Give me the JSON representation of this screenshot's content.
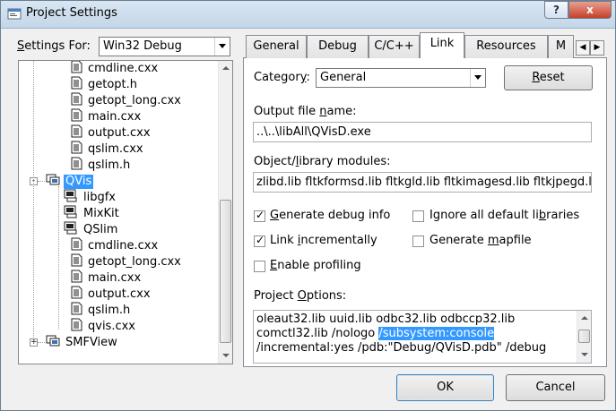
{
  "window": {
    "title": "Project Settings",
    "help_label": "?",
    "close_label": "x"
  },
  "settings_for": {
    "label_pre": "",
    "label_u": "S",
    "label_post": "ettings For:",
    "value": "Win32 Debug"
  },
  "tree": {
    "rows": [
      {
        "label": "cmdline.cxx",
        "kind": "file"
      },
      {
        "label": "getopt.h",
        "kind": "file"
      },
      {
        "label": "getopt_long.cxx",
        "kind": "file"
      },
      {
        "label": "main.cxx",
        "kind": "file"
      },
      {
        "label": "output.cxx",
        "kind": "file"
      },
      {
        "label": "qslim.cxx",
        "kind": "file"
      },
      {
        "label": "qslim.h",
        "kind": "file"
      },
      {
        "label": "QVis",
        "kind": "project",
        "expander": "-",
        "selected": true
      },
      {
        "label": "libgfx",
        "kind": "dep"
      },
      {
        "label": "MixKit",
        "kind": "dep"
      },
      {
        "label": "QSlim",
        "kind": "dep"
      },
      {
        "label": "cmdline.cxx",
        "kind": "file"
      },
      {
        "label": "getopt_long.cxx",
        "kind": "file"
      },
      {
        "label": "main.cxx",
        "kind": "file"
      },
      {
        "label": "output.cxx",
        "kind": "file"
      },
      {
        "label": "qslim.h",
        "kind": "file"
      },
      {
        "label": "qvis.cxx",
        "kind": "file"
      },
      {
        "label": "SMFView",
        "kind": "project",
        "expander": "+"
      }
    ]
  },
  "tabs": [
    {
      "label": "General"
    },
    {
      "label": "Debug"
    },
    {
      "label": "C/C++"
    },
    {
      "label": "Link",
      "active": true
    },
    {
      "label": "Resources"
    },
    {
      "label": "M"
    }
  ],
  "tab_scroll": {
    "left": "◀",
    "right": "▶"
  },
  "category": {
    "label_pre": "Categor",
    "label_u": "y",
    "label_post": ":",
    "value": "General",
    "reset_pre": "",
    "reset_u": "R",
    "reset_post": "eset"
  },
  "output_file": {
    "label_pre": "Output file ",
    "label_u": "n",
    "label_post": "ame:",
    "value": "..\\..\\libAll\\QVisD.exe"
  },
  "object_modules": {
    "label_pre": "Object/",
    "label_u": "l",
    "label_post": "ibrary modules:",
    "value": "zlibd.lib fltkformsd.lib fltkgld.lib fltkimagesd.lib fltkjpegd.li"
  },
  "checkboxes": {
    "generate_debug": {
      "pre": "",
      "u": "G",
      "post": "enerate debug info",
      "checked": true
    },
    "link_incrementally": {
      "pre": "Link ",
      "u": "i",
      "post": "ncrementally",
      "checked": true
    },
    "enable_profiling": {
      "pre": "",
      "u": "E",
      "post": "nable profiling",
      "checked": false
    },
    "ignore_default_libs": {
      "pre": "Ignore all default li",
      "u": "b",
      "post": "raries",
      "checked": false
    },
    "generate_mapfile": {
      "pre": "Generate ",
      "u": "m",
      "post": "apfile",
      "checked": false
    }
  },
  "project_options": {
    "label_pre": "Project ",
    "label_u": "O",
    "label_post": "ptions:",
    "line1": "oleaut32.lib uuid.lib odbc32.lib odbccp32.lib",
    "line2_pre": "comctl32.lib /nologo ",
    "line2_hl": "/subsystem:console",
    "line3": "/incremental:yes /pdb:\"Debug/QVisD.pdb\" /debug"
  },
  "buttons": {
    "ok": "OK",
    "cancel": "Cancel"
  }
}
